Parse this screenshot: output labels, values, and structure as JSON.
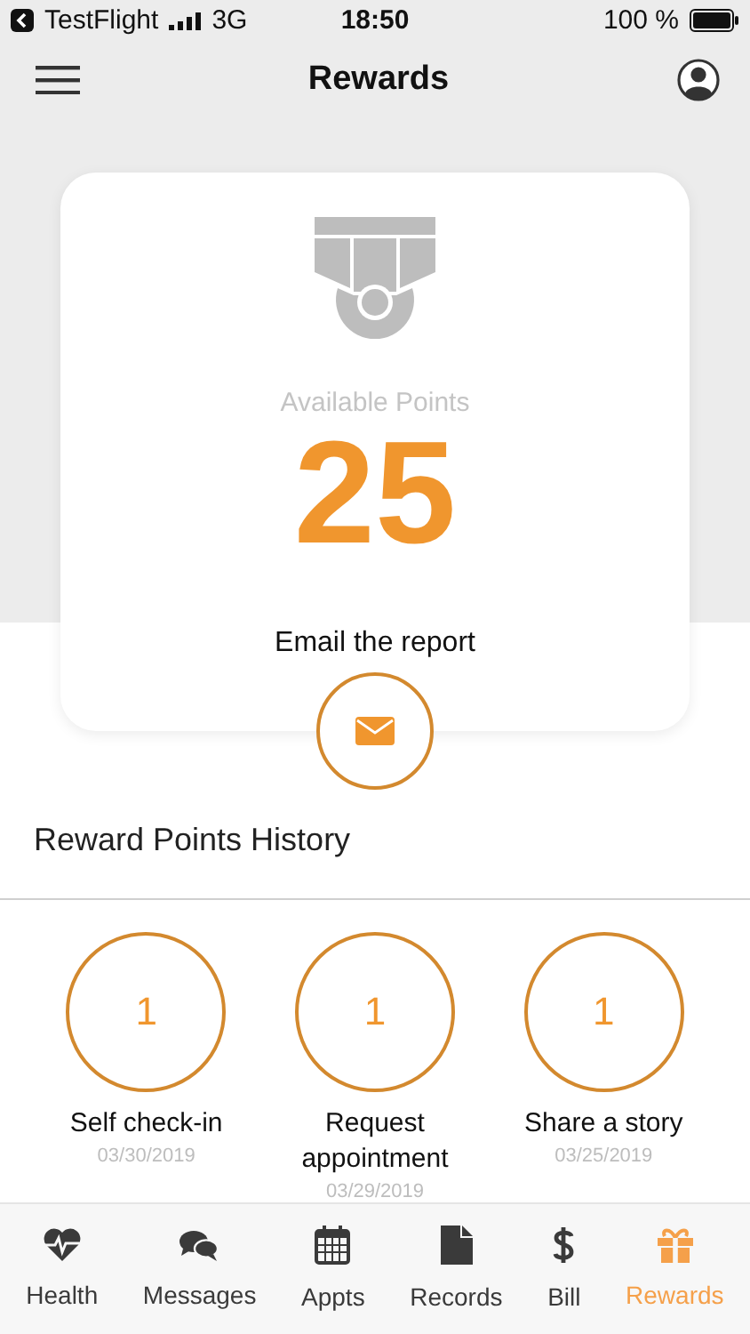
{
  "status_bar": {
    "back_app": "TestFlight",
    "network": "3G",
    "time": "18:50",
    "battery": "100 %"
  },
  "header": {
    "title": "Rewards"
  },
  "points": {
    "label": "Available Points",
    "value": "25",
    "action": "Email the report"
  },
  "history": {
    "title": "Reward Points History",
    "items": [
      {
        "points": "1",
        "name": "Self check-in",
        "date": "03/30/2019"
      },
      {
        "points": "1",
        "name": "Request appointment",
        "date": "03/29/2019"
      },
      {
        "points": "1",
        "name": "Share a story",
        "date": "03/25/2019"
      }
    ]
  },
  "tabs": [
    {
      "label": "Health",
      "kind": "heart",
      "selected": false
    },
    {
      "label": "Messages",
      "kind": "chat",
      "selected": false
    },
    {
      "label": "Appts",
      "kind": "calendar",
      "selected": false
    },
    {
      "label": "Records",
      "kind": "document",
      "selected": false
    },
    {
      "label": "Bill",
      "kind": "dollar",
      "selected": false
    },
    {
      "label": "Rewards",
      "kind": "gift",
      "selected": true
    }
  ]
}
